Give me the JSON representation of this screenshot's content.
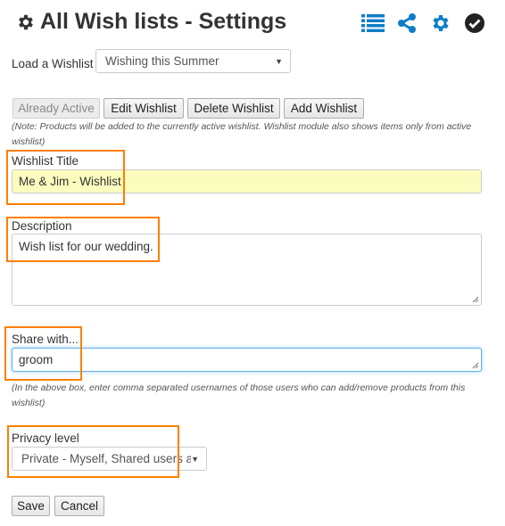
{
  "header": {
    "title": "All Wish lists - Settings",
    "title_icon": "gear-icon",
    "toolbar_icons": [
      "list-icon",
      "share-icon",
      "gear-icon",
      "check-circle-icon"
    ],
    "accent_color": "#0d7dc7"
  },
  "load": {
    "label": "Load a Wishlist",
    "selected": "Wishing this Summer"
  },
  "buttons": {
    "already_active": "Already Active",
    "edit": "Edit Wishlist",
    "delete": "Delete Wishlist",
    "add": "Add Wishlist"
  },
  "notes": {
    "active_note": "(Note: Products will be added to the currently active wishlist. Wishlist module also shows items only from active wishlist)",
    "share_note": "(In the above box, enter comma separated usernames of those users who can add/remove products from this wishlist)"
  },
  "form": {
    "title_label": "Wishlist Title",
    "title_value": "Me & Jim - Wishlist",
    "description_label": "Description",
    "description_value": "Wish list for our wedding.",
    "share_label": "Share with...",
    "share_value": "groom",
    "privacy_label": "Privacy level",
    "privacy_selected": "Private - Myself, Shared users a"
  },
  "actions": {
    "save": "Save",
    "cancel": "Cancel"
  },
  "highlight_color": "#ff7f00"
}
